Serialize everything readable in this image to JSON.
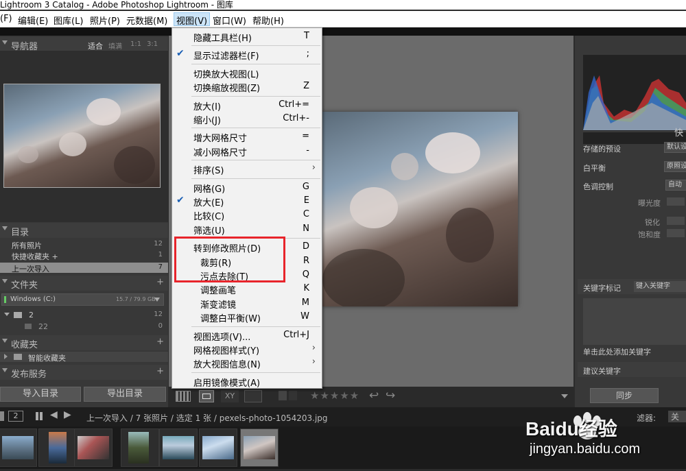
{
  "window_title": "Lightroom 3 Catalog - Adobe Photoshop Lightroom - 图库",
  "menubar": [
    {
      "label": "(F)",
      "active": false
    },
    {
      "label": "编辑(E)",
      "active": false
    },
    {
      "label": "图库(L)",
      "active": false
    },
    {
      "label": "照片(P)",
      "active": false
    },
    {
      "label": "元数据(M)",
      "active": false
    },
    {
      "label": "视图(V)",
      "active": true
    },
    {
      "label": "窗口(W)",
      "active": false
    },
    {
      "label": "帮助(H)",
      "active": false
    }
  ],
  "left_panel": {
    "navigator": {
      "title": "导航器",
      "options": [
        "适合",
        "填满",
        "1:1",
        "3:1"
      ]
    },
    "catalog": {
      "title": "目录",
      "items": [
        {
          "label": "所有照片",
          "count": "12"
        },
        {
          "label": "快捷收藏夹 +",
          "count": "1"
        },
        {
          "label": "上一次导入",
          "count": "7",
          "selected": true
        }
      ]
    },
    "folders": {
      "title": "文件夹",
      "drive": {
        "label": "Windows (C:)",
        "size": "15.7 / 79.9 GB"
      },
      "items": [
        {
          "label": "2",
          "count": "12"
        },
        {
          "label": "22",
          "count": "0"
        }
      ]
    },
    "collections": {
      "title": "收藏夹",
      "items": [
        {
          "label": "智能收藏夹"
        }
      ]
    },
    "publish": {
      "title": "发布服务"
    },
    "import_button": "导入目录",
    "export_button": "导出目录"
  },
  "right_panel": {
    "quick_develop_title": "快",
    "rows": [
      {
        "label": "存储的预设",
        "value": "默认设"
      },
      {
        "label": "白平衡",
        "value": "原照设"
      },
      {
        "label": "色调控制",
        "value": "自动"
      }
    ],
    "sub_labels": [
      "曝光度",
      "锐化",
      "饱和度"
    ],
    "keywords_label": "关键字标记",
    "keywords_value": "键入关键字",
    "add_keyword_hint": "单击此处添加关键字",
    "suggested_keywords": "建议关键字",
    "sync_button": "同步"
  },
  "toolbar": {
    "stars": "★★★★★"
  },
  "status_bar": {
    "page_left": "1",
    "page_right": "2",
    "breadcrumb": "上一次导入 / 7 张照片 / 选定 1 张 / pexels-photo-1054203.jpg",
    "filter_label": "滤器:",
    "filter_value": "关"
  },
  "view_menu": {
    "items": [
      {
        "label": "隐藏工具栏(H)",
        "shortcut": "T",
        "checked": false,
        "submenu": false
      },
      {
        "separator": true
      },
      {
        "label": "显示过滤器栏(F)",
        "shortcut": ";",
        "checked": true,
        "submenu": false
      },
      {
        "separator": true
      },
      {
        "label": "切换放大视图(L)",
        "shortcut": "",
        "checked": false,
        "submenu": false
      },
      {
        "label": "切换缩放视图(Z)",
        "shortcut": "Z",
        "checked": false,
        "submenu": false
      },
      {
        "separator": true
      },
      {
        "label": "放大(I)",
        "shortcut": "Ctrl+=",
        "checked": false,
        "submenu": false
      },
      {
        "label": "缩小(J)",
        "shortcut": "Ctrl+-",
        "checked": false,
        "submenu": false
      },
      {
        "separator": true
      },
      {
        "label": "增大网格尺寸",
        "shortcut": "=",
        "checked": false,
        "submenu": false
      },
      {
        "label": "减小网格尺寸",
        "shortcut": "-",
        "checked": false,
        "submenu": false
      },
      {
        "separator": true
      },
      {
        "label": "排序(S)",
        "shortcut": "",
        "checked": false,
        "submenu": true
      },
      {
        "separator": true
      },
      {
        "label": "网格(G)",
        "shortcut": "G",
        "checked": false,
        "submenu": false
      },
      {
        "label": "放大(E)",
        "shortcut": "E",
        "checked": true,
        "submenu": false
      },
      {
        "label": "比较(C)",
        "shortcut": "C",
        "checked": false,
        "submenu": false
      },
      {
        "label": "筛选(U)",
        "shortcut": "N",
        "checked": false,
        "submenu": false
      },
      {
        "separator": true
      },
      {
        "label": "转到修改照片(D)",
        "shortcut": "D",
        "checked": false,
        "submenu": false
      },
      {
        "label": "裁剪(R)",
        "shortcut": "R",
        "checked": false,
        "submenu": false,
        "indent": true
      },
      {
        "label": "污点去除(T)",
        "shortcut": "Q",
        "checked": false,
        "submenu": false,
        "indent": true
      },
      {
        "label": "调整画笔",
        "shortcut": "K",
        "checked": false,
        "submenu": false,
        "indent": true
      },
      {
        "label": "渐变滤镜",
        "shortcut": "M",
        "checked": false,
        "submenu": false,
        "indent": true
      },
      {
        "label": "调整白平衡(W)",
        "shortcut": "W",
        "checked": false,
        "submenu": false,
        "indent": true
      },
      {
        "separator": true
      },
      {
        "label": "视图选项(V)...",
        "shortcut": "Ctrl+J",
        "checked": false,
        "submenu": false
      },
      {
        "label": "网格视图样式(Y)",
        "shortcut": "",
        "checked": false,
        "submenu": true
      },
      {
        "label": "放大视图信息(N)",
        "shortcut": "",
        "checked": false,
        "submenu": true
      },
      {
        "separator": true
      },
      {
        "label": "启用镜像模式(A)",
        "shortcut": "",
        "checked": false,
        "submenu": false
      }
    ]
  },
  "watermark": {
    "brand": "Baidu经验",
    "url": "jingyan.baidu.com"
  }
}
